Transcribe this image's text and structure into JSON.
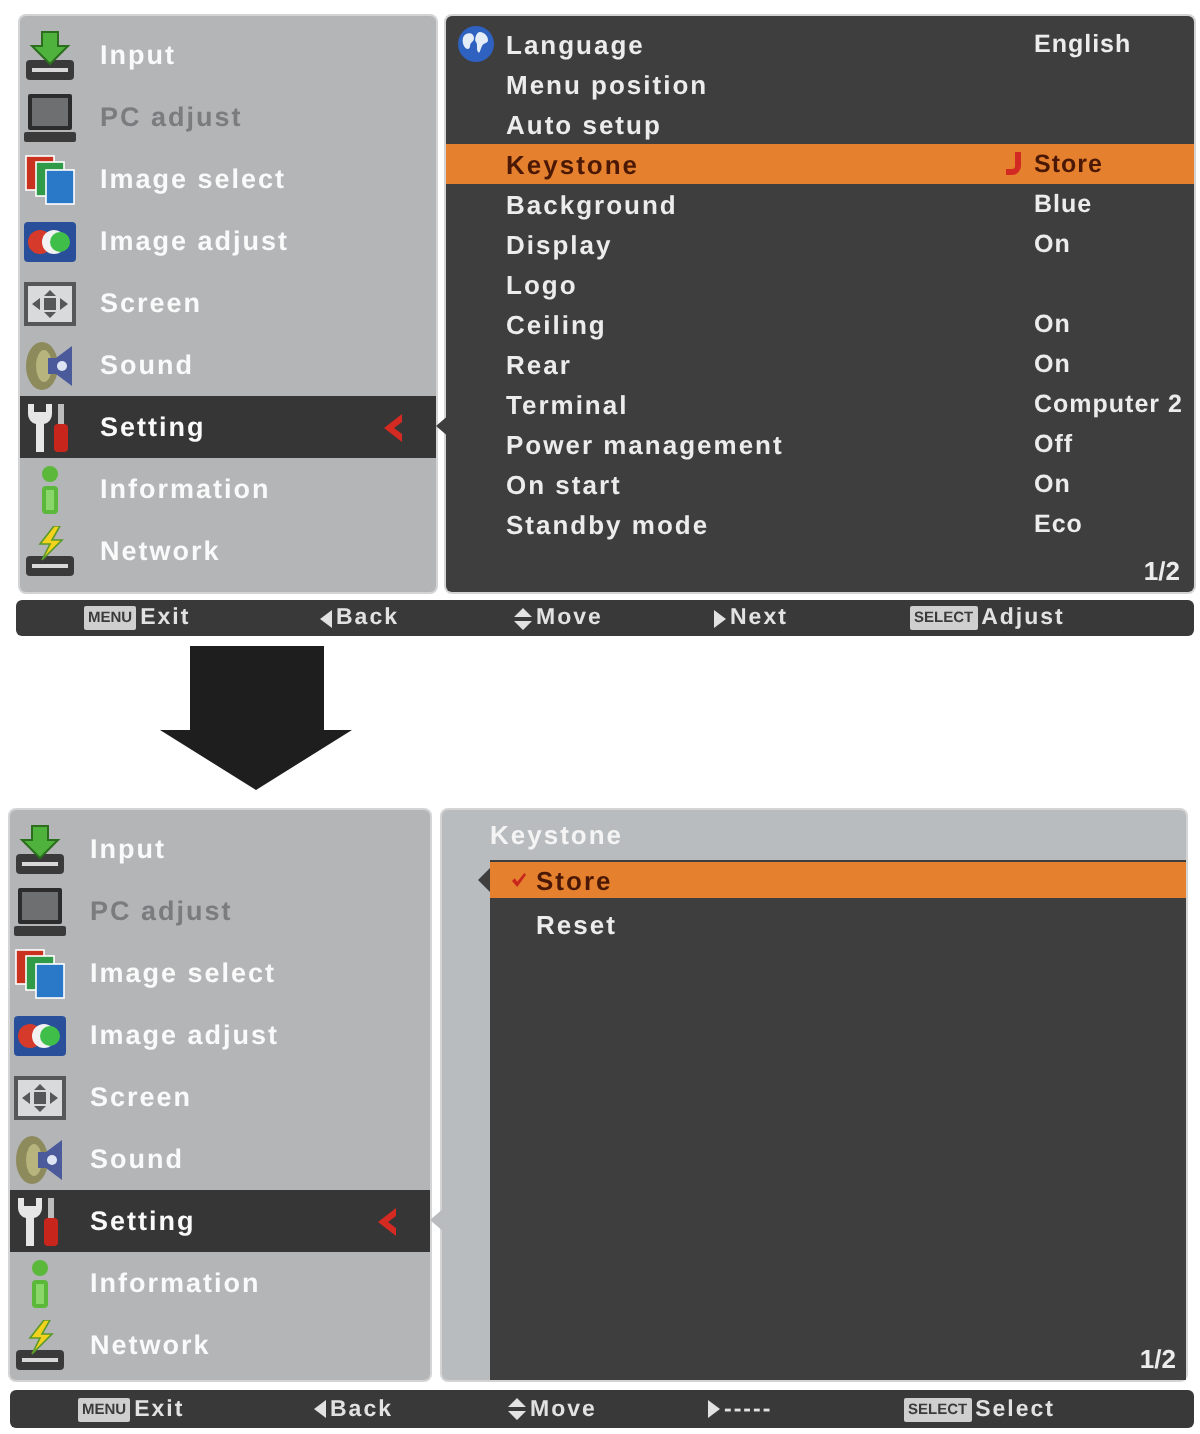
{
  "screens": [
    {
      "menu": [
        {
          "kind": "input",
          "label": "Input",
          "selected": false,
          "disabled": false
        },
        {
          "kind": "pc",
          "label": "PC adjust",
          "selected": false,
          "disabled": true
        },
        {
          "kind": "images",
          "label": "Image select",
          "selected": false,
          "disabled": false
        },
        {
          "kind": "colors",
          "label": "Image adjust",
          "selected": false,
          "disabled": false
        },
        {
          "kind": "screen",
          "label": "Screen",
          "selected": false,
          "disabled": false
        },
        {
          "kind": "sound",
          "label": "Sound",
          "selected": false,
          "disabled": false
        },
        {
          "kind": "setting",
          "label": "Setting",
          "selected": true,
          "disabled": false
        },
        {
          "kind": "info",
          "label": "Information",
          "selected": false,
          "disabled": false
        },
        {
          "kind": "network",
          "label": "Network",
          "selected": false,
          "disabled": false
        }
      ],
      "panel": {
        "kind": "settings",
        "items": [
          {
            "label": "Language",
            "value": "English",
            "selected": false
          },
          {
            "label": "Menu position",
            "selected": false
          },
          {
            "label": "Auto setup",
            "selected": false
          },
          {
            "label": "Keystone",
            "value": "Store",
            "selected": true
          },
          {
            "label": "Background",
            "value": "Blue",
            "selected": false
          },
          {
            "label": "Display",
            "value": "On",
            "selected": false
          },
          {
            "label": "Logo",
            "selected": false
          },
          {
            "label": "Ceiling",
            "value": "On",
            "selected": false
          },
          {
            "label": "Rear",
            "value": "On",
            "selected": false
          },
          {
            "label": "Terminal",
            "value": "Computer 2",
            "selected": false
          },
          {
            "label": "Power management",
            "value": "Off",
            "selected": false
          },
          {
            "label": "On start",
            "value": "On",
            "selected": false
          },
          {
            "label": "Standby mode",
            "value": "Eco",
            "selected": false
          }
        ],
        "page": "1/2"
      },
      "footer": [
        {
          "kind": "key",
          "key": "MENU",
          "label": "Exit"
        },
        {
          "kind": "left",
          "label": "Back"
        },
        {
          "kind": "updown",
          "label": "Move"
        },
        {
          "kind": "right",
          "label": "Next"
        },
        {
          "kind": "key",
          "key": "SELECT",
          "label": "Adjust"
        }
      ]
    },
    {
      "menu": [
        {
          "kind": "input",
          "label": "Input",
          "selected": false,
          "disabled": false
        },
        {
          "kind": "pc",
          "label": "PC adjust",
          "selected": false,
          "disabled": true
        },
        {
          "kind": "images",
          "label": "Image select",
          "selected": false,
          "disabled": false
        },
        {
          "kind": "colors",
          "label": "Image adjust",
          "selected": false,
          "disabled": false
        },
        {
          "kind": "screen",
          "label": "Screen",
          "selected": false,
          "disabled": false
        },
        {
          "kind": "sound",
          "label": "Sound",
          "selected": false,
          "disabled": false
        },
        {
          "kind": "setting",
          "label": "Setting",
          "selected": true,
          "disabled": false
        },
        {
          "kind": "info",
          "label": "Information",
          "selected": false,
          "disabled": false
        },
        {
          "kind": "network",
          "label": "Network",
          "selected": false,
          "disabled": false
        }
      ],
      "panel": {
        "kind": "submenu",
        "title": "Keystone",
        "items": [
          {
            "label": "Store",
            "selected": true,
            "checked": true
          },
          {
            "label": "Reset",
            "selected": false,
            "checked": false
          }
        ],
        "page": "1/2"
      },
      "footer": [
        {
          "kind": "key",
          "key": "MENU",
          "label": "Exit"
        },
        {
          "kind": "left",
          "label": "Back"
        },
        {
          "kind": "updown",
          "label": "Move"
        },
        {
          "kind": "right",
          "label": "-----"
        },
        {
          "kind": "key",
          "key": "SELECT",
          "label": "Select"
        }
      ]
    }
  ]
}
